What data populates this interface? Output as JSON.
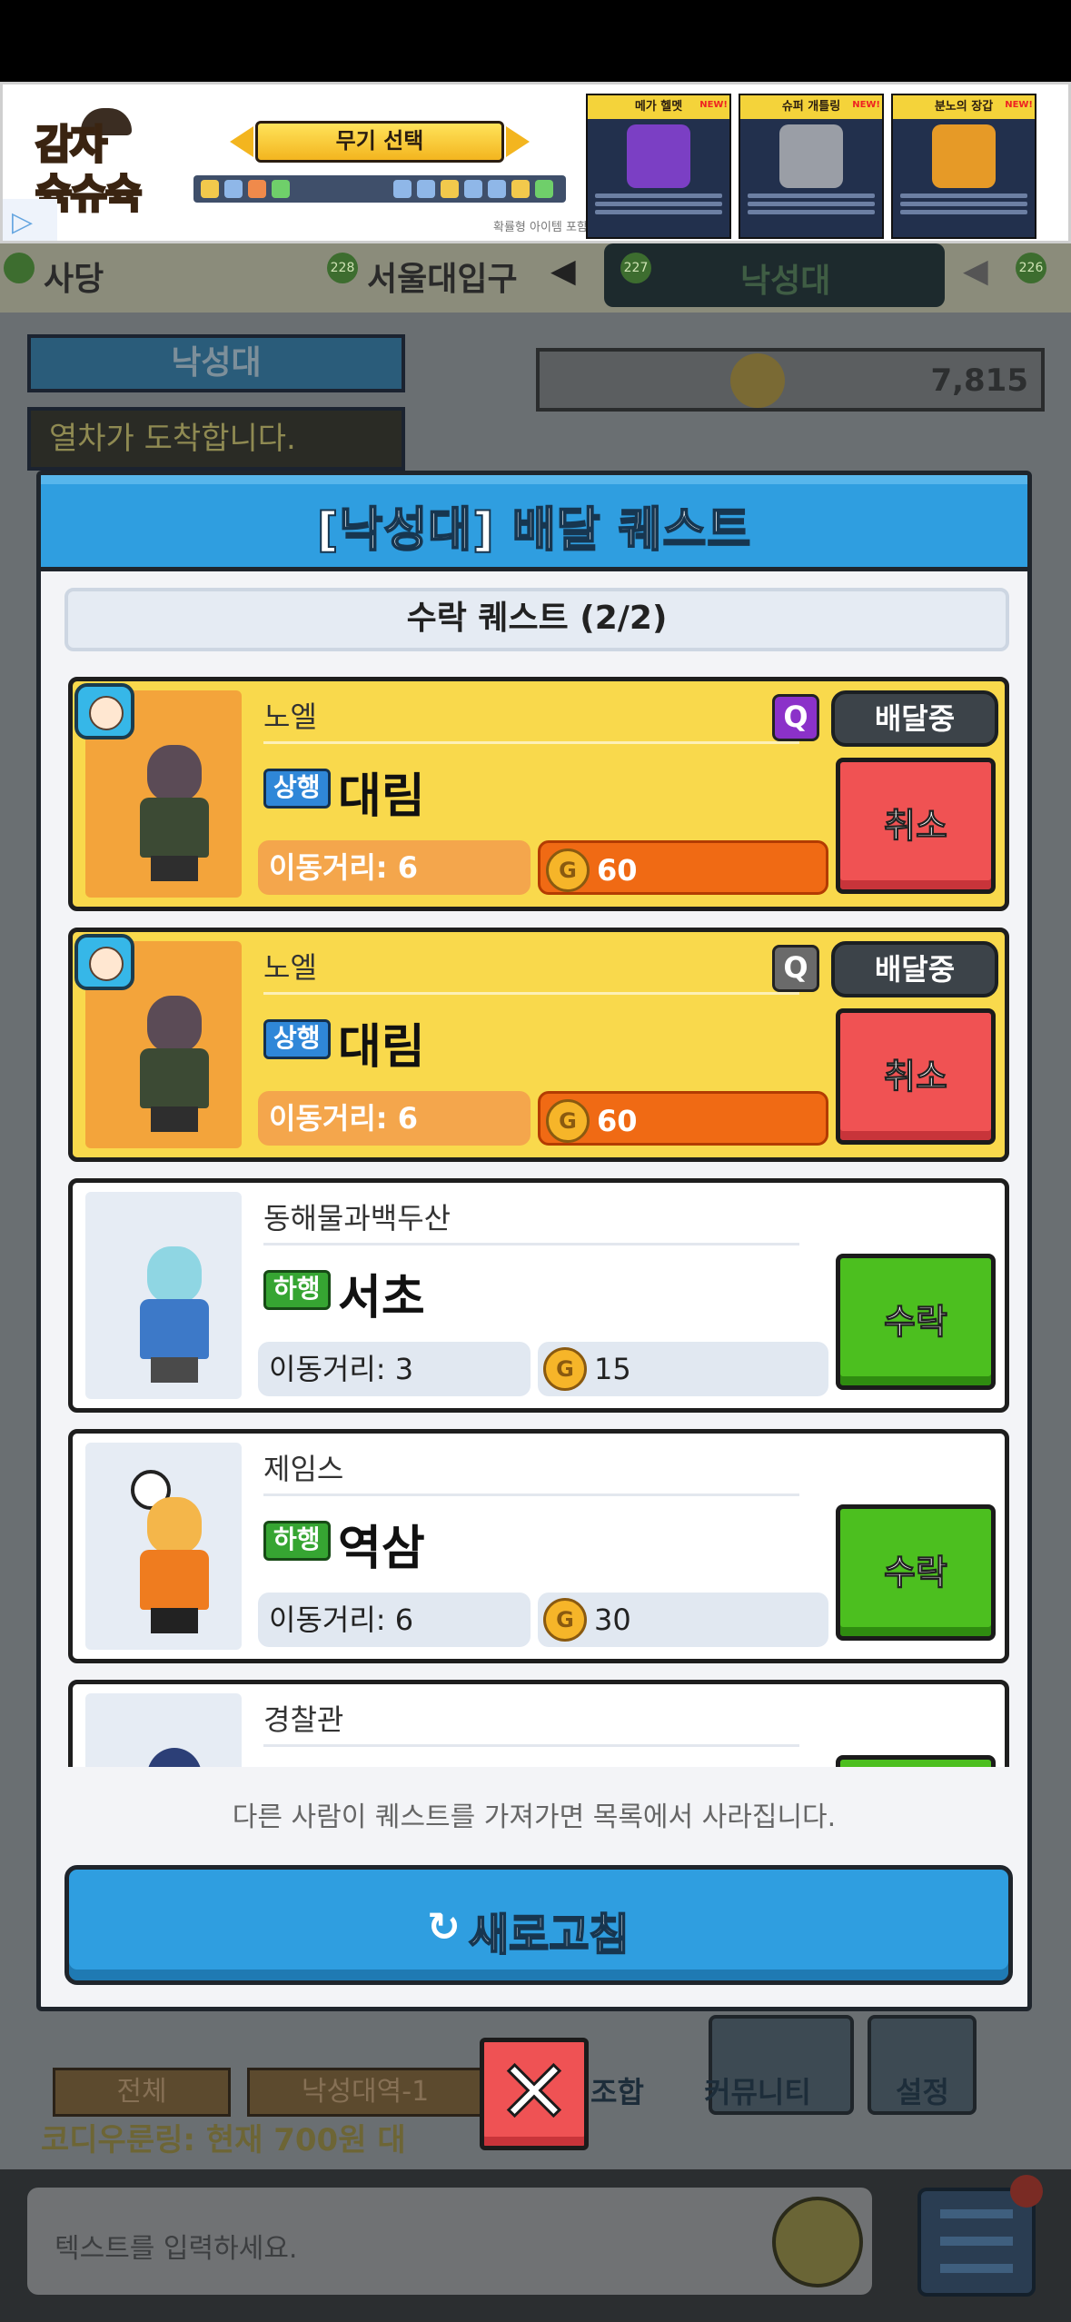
{
  "ad": {
    "logo_line1": "감자",
    "logo_line2": "슉슈슉",
    "weapon_select": "무기 선택",
    "footer": "확률형 아이템 포함",
    "cards": [
      {
        "title": "메가 헬멧",
        "badge": "NEW!"
      },
      {
        "title": "슈퍼 개틀링",
        "badge": "NEW!"
      },
      {
        "title": "분노의 장갑",
        "badge": "NEW!"
      }
    ]
  },
  "background": {
    "station_left": "사당",
    "station_prev": "서울대입구",
    "station_prev_num": "228",
    "station_current": "낙성대",
    "station_current_num": "227",
    "station_next_num": "226",
    "left_panel_title": "낙성대",
    "left_panel_msg": "열차가 도착합니다.",
    "coins": "7,815",
    "tab_all": "전체",
    "tab_station": "낙성대역-1",
    "tab_community": "커뮤니티",
    "tab_settings": "설정",
    "tab_combine": "조합",
    "ticker": "코디우룬링: 현재 700원 대",
    "chat_placeholder": "텍스트를 입력하세요."
  },
  "modal": {
    "title": "[낙성대] 배달 퀘스트",
    "subtitle": "수락 퀘스트 (2/2)",
    "notice": "다른 사람이 퀘스트를 가져가면 목록에서 사라집니다.",
    "refresh_icon": "↻",
    "refresh_label": "새로고침",
    "close_label": "✕"
  },
  "quests": [
    {
      "npc": "노엘",
      "direction": "상행",
      "destination": "대림",
      "distance": "이동거리: 6",
      "reward": "60",
      "q": "Q",
      "status": "배달중",
      "action": "취소",
      "state": "accepted",
      "q_active": true
    },
    {
      "npc": "노엘",
      "direction": "상행",
      "destination": "대림",
      "distance": "이동거리: 6",
      "reward": "60",
      "q": "Q",
      "status": "배달중",
      "action": "취소",
      "state": "accepted",
      "q_active": false
    },
    {
      "npc": "동해물과백두산",
      "direction": "하행",
      "destination": "서초",
      "distance": "이동거리: 3",
      "reward": "15",
      "action": "수락",
      "state": "open"
    },
    {
      "npc": "제임스",
      "direction": "하행",
      "destination": "역삼",
      "distance": "이동거리: 6",
      "reward": "30",
      "action": "수락",
      "state": "open"
    },
    {
      "npc": "경찰관",
      "state": "open"
    }
  ],
  "colors": {
    "modal_blue": "#2f9ee0",
    "accepted_card": "#f9d94c",
    "cancel_red": "#f05253",
    "accept_green": "#4cbf1f",
    "reward_orange": "#f06a14"
  }
}
